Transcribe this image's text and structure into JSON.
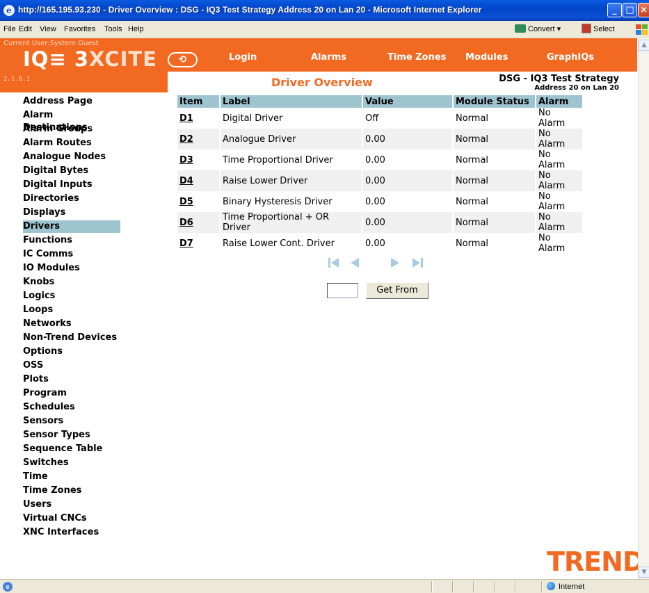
{
  "browser": {
    "title": "http://165.195.93.230 - Driver Overview : DSG - IQ3 Test Strategy Address 20 on Lan 20 - Microsoft Internet Explorer",
    "menu": [
      "File",
      "Edit",
      "View",
      "Favorites",
      "Tools",
      "Help"
    ],
    "convert_label": "Convert",
    "select_label": "Select",
    "status_zone": "Internet"
  },
  "header": {
    "current_user": "Current User:System Guest",
    "logo_text": "IQ≡ 3",
    "logo_text_2": "XCITE",
    "version": "2.1.6.1",
    "nav": [
      "Login",
      "Alarms",
      "Time Zones",
      "Modules",
      "GraphIQs"
    ]
  },
  "page": {
    "heading": "Driver Overview",
    "strategy_name": "DSG - IQ3 Test Strategy",
    "strategy_address": "Address 20 on Lan 20"
  },
  "sidebar": {
    "items": [
      "Address Page",
      "Alarm Destinations",
      "Alarm Groups",
      "Alarm Routes",
      "Analogue Nodes",
      "Digital Bytes",
      "Digital Inputs",
      "Directories",
      "Displays",
      "Drivers",
      "Functions",
      "IC Comms",
      "IO Modules",
      "Knobs",
      "Logics",
      "Loops",
      "Networks",
      "Non-Trend Devices",
      "Options",
      "OSS",
      "Plots",
      "Program",
      "Schedules",
      "Sensors",
      "Sensor Types",
      "Sequence Table",
      "Switches",
      "Time",
      "Time Zones",
      "Users",
      "Virtual CNCs",
      "XNC Interfaces"
    ],
    "active": "Drivers"
  },
  "table": {
    "columns": [
      "Item",
      "Label",
      "Value",
      "Module Status",
      "Alarm"
    ],
    "rows": [
      [
        "D1",
        "Digital Driver",
        "Off",
        "Normal",
        "No Alarm"
      ],
      [
        "D2",
        "Analogue Driver",
        "0.00",
        "Normal",
        "No Alarm"
      ],
      [
        "D3",
        "Time Proportional Driver",
        "0.00",
        "Normal",
        "No Alarm"
      ],
      [
        "D4",
        "Raise Lower Driver",
        "0.00",
        "Normal",
        "No Alarm"
      ],
      [
        "D5",
        "Binary Hysteresis Driver",
        "0.00",
        "Normal",
        "No Alarm"
      ],
      [
        "D6",
        "Time Proportional + OR Driver",
        "0.00",
        "Normal",
        "No Alarm"
      ],
      [
        "D7",
        "Raise Lower Cont. Driver",
        "0.00",
        "Normal",
        "No Alarm"
      ]
    ]
  },
  "pager": {
    "get_from_label": "Get From",
    "get_from_value": ""
  },
  "footer": {
    "brand": "TREND"
  },
  "colors": {
    "brand_orange": "#f26a21",
    "header_blue": "#9ec4d0"
  }
}
